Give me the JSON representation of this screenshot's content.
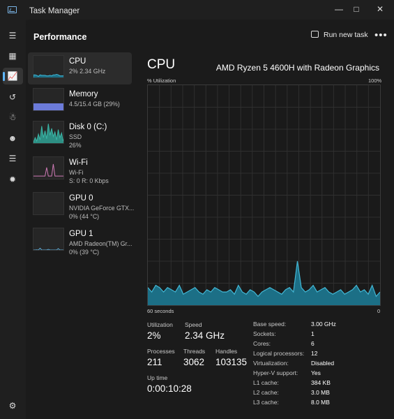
{
  "window": {
    "title": "Task Manager"
  },
  "header": {
    "page_title": "Performance",
    "run_task_label": "Run new task",
    "more_label": "•••"
  },
  "sidebar": {
    "items": [
      {
        "name": "CPU",
        "sub1": "2%  2.34 GHz",
        "sub2": ""
      },
      {
        "name": "Memory",
        "sub1": "4.5/15.4 GB (29%)",
        "sub2": ""
      },
      {
        "name": "Disk 0 (C:)",
        "sub1": "SSD",
        "sub2": "26%"
      },
      {
        "name": "Wi-Fi",
        "sub1": "Wi-Fi",
        "sub2": "S: 0 R: 0 Kbps"
      },
      {
        "name": "GPU 0",
        "sub1": "NVIDIA GeForce GTX...",
        "sub2": "0%  (44 °C)"
      },
      {
        "name": "GPU 1",
        "sub1": "AMD Radeon(TM) Gr...",
        "sub2": "0%  (39 °C)"
      }
    ]
  },
  "cpu": {
    "heading": "CPU",
    "model": "AMD Ryzen 5 4600H with Radeon Graphics",
    "graph": {
      "y_label": "% Utilization",
      "y_max_label": "100%",
      "x_left_label": "60 seconds",
      "x_right_label": "0",
      "utilization_history": [
        8,
        6,
        9,
        8,
        6,
        8,
        7,
        6,
        9,
        5,
        6,
        7,
        8,
        6,
        5,
        7,
        6,
        8,
        7,
        6,
        6,
        7,
        5,
        9,
        6,
        5,
        7,
        6,
        4,
        6,
        7,
        8,
        7,
        6,
        5,
        7,
        8,
        6,
        20,
        8,
        6,
        7,
        9,
        6,
        7,
        8,
        6,
        5,
        6,
        7,
        5,
        6,
        7,
        9,
        6,
        7,
        5,
        9,
        4,
        6
      ]
    },
    "stats": {
      "utilization_label": "Utilization",
      "utilization": "2%",
      "speed_label": "Speed",
      "speed": "2.34 GHz",
      "processes_label": "Processes",
      "processes": "211",
      "threads_label": "Threads",
      "threads": "3062",
      "handles_label": "Handles",
      "handles": "103135",
      "uptime_label": "Up time",
      "uptime": "0:00:10:28"
    },
    "specs": [
      {
        "k": "Base speed:",
        "v": "3.00 GHz"
      },
      {
        "k": "Sockets:",
        "v": "1"
      },
      {
        "k": "Cores:",
        "v": "6"
      },
      {
        "k": "Logical processors:",
        "v": "12"
      },
      {
        "k": "Virtualization:",
        "v": "Disabled"
      },
      {
        "k": "Hyper-V support:",
        "v": "Yes"
      },
      {
        "k": "L1 cache:",
        "v": "384 KB"
      },
      {
        "k": "L2 cache:",
        "v": "3.0 MB"
      },
      {
        "k": "L3 cache:",
        "v": "8.0 MB"
      }
    ]
  },
  "colors": {
    "cpu_line": "#42b8d6",
    "cpu_fill": "#1c6f86",
    "memory": "#6c7bd9",
    "disk": "#3bb5a6",
    "wifi": "#cf7ab6",
    "gpu": "#5ea9d4",
    "accent": "#5fb7ff"
  }
}
